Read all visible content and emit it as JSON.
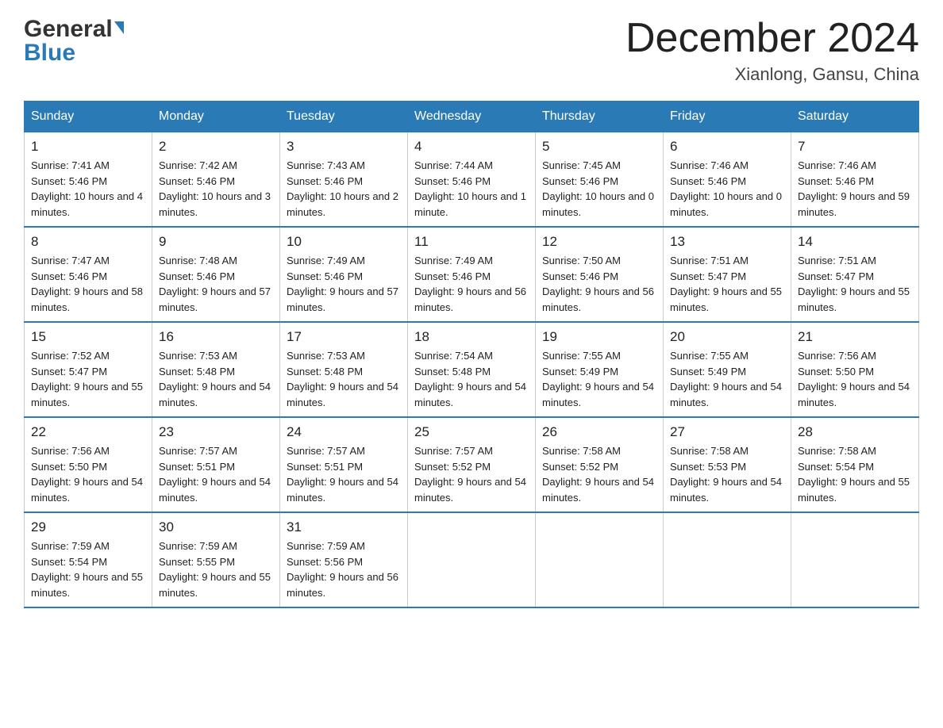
{
  "header": {
    "logo_general": "General",
    "logo_blue": "Blue",
    "month_title": "December 2024",
    "location": "Xianlong, Gansu, China"
  },
  "weekdays": [
    "Sunday",
    "Monday",
    "Tuesday",
    "Wednesday",
    "Thursday",
    "Friday",
    "Saturday"
  ],
  "weeks": [
    [
      {
        "day": "1",
        "sunrise": "7:41 AM",
        "sunset": "5:46 PM",
        "daylight": "10 hours and 4 minutes."
      },
      {
        "day": "2",
        "sunrise": "7:42 AM",
        "sunset": "5:46 PM",
        "daylight": "10 hours and 3 minutes."
      },
      {
        "day": "3",
        "sunrise": "7:43 AM",
        "sunset": "5:46 PM",
        "daylight": "10 hours and 2 minutes."
      },
      {
        "day": "4",
        "sunrise": "7:44 AM",
        "sunset": "5:46 PM",
        "daylight": "10 hours and 1 minute."
      },
      {
        "day": "5",
        "sunrise": "7:45 AM",
        "sunset": "5:46 PM",
        "daylight": "10 hours and 0 minutes."
      },
      {
        "day": "6",
        "sunrise": "7:46 AM",
        "sunset": "5:46 PM",
        "daylight": "10 hours and 0 minutes."
      },
      {
        "day": "7",
        "sunrise": "7:46 AM",
        "sunset": "5:46 PM",
        "daylight": "9 hours and 59 minutes."
      }
    ],
    [
      {
        "day": "8",
        "sunrise": "7:47 AM",
        "sunset": "5:46 PM",
        "daylight": "9 hours and 58 minutes."
      },
      {
        "day": "9",
        "sunrise": "7:48 AM",
        "sunset": "5:46 PM",
        "daylight": "9 hours and 57 minutes."
      },
      {
        "day": "10",
        "sunrise": "7:49 AM",
        "sunset": "5:46 PM",
        "daylight": "9 hours and 57 minutes."
      },
      {
        "day": "11",
        "sunrise": "7:49 AM",
        "sunset": "5:46 PM",
        "daylight": "9 hours and 56 minutes."
      },
      {
        "day": "12",
        "sunrise": "7:50 AM",
        "sunset": "5:46 PM",
        "daylight": "9 hours and 56 minutes."
      },
      {
        "day": "13",
        "sunrise": "7:51 AM",
        "sunset": "5:47 PM",
        "daylight": "9 hours and 55 minutes."
      },
      {
        "day": "14",
        "sunrise": "7:51 AM",
        "sunset": "5:47 PM",
        "daylight": "9 hours and 55 minutes."
      }
    ],
    [
      {
        "day": "15",
        "sunrise": "7:52 AM",
        "sunset": "5:47 PM",
        "daylight": "9 hours and 55 minutes."
      },
      {
        "day": "16",
        "sunrise": "7:53 AM",
        "sunset": "5:48 PM",
        "daylight": "9 hours and 54 minutes."
      },
      {
        "day": "17",
        "sunrise": "7:53 AM",
        "sunset": "5:48 PM",
        "daylight": "9 hours and 54 minutes."
      },
      {
        "day": "18",
        "sunrise": "7:54 AM",
        "sunset": "5:48 PM",
        "daylight": "9 hours and 54 minutes."
      },
      {
        "day": "19",
        "sunrise": "7:55 AM",
        "sunset": "5:49 PM",
        "daylight": "9 hours and 54 minutes."
      },
      {
        "day": "20",
        "sunrise": "7:55 AM",
        "sunset": "5:49 PM",
        "daylight": "9 hours and 54 minutes."
      },
      {
        "day": "21",
        "sunrise": "7:56 AM",
        "sunset": "5:50 PM",
        "daylight": "9 hours and 54 minutes."
      }
    ],
    [
      {
        "day": "22",
        "sunrise": "7:56 AM",
        "sunset": "5:50 PM",
        "daylight": "9 hours and 54 minutes."
      },
      {
        "day": "23",
        "sunrise": "7:57 AM",
        "sunset": "5:51 PM",
        "daylight": "9 hours and 54 minutes."
      },
      {
        "day": "24",
        "sunrise": "7:57 AM",
        "sunset": "5:51 PM",
        "daylight": "9 hours and 54 minutes."
      },
      {
        "day": "25",
        "sunrise": "7:57 AM",
        "sunset": "5:52 PM",
        "daylight": "9 hours and 54 minutes."
      },
      {
        "day": "26",
        "sunrise": "7:58 AM",
        "sunset": "5:52 PM",
        "daylight": "9 hours and 54 minutes."
      },
      {
        "day": "27",
        "sunrise": "7:58 AM",
        "sunset": "5:53 PM",
        "daylight": "9 hours and 54 minutes."
      },
      {
        "day": "28",
        "sunrise": "7:58 AM",
        "sunset": "5:54 PM",
        "daylight": "9 hours and 55 minutes."
      }
    ],
    [
      {
        "day": "29",
        "sunrise": "7:59 AM",
        "sunset": "5:54 PM",
        "daylight": "9 hours and 55 minutes."
      },
      {
        "day": "30",
        "sunrise": "7:59 AM",
        "sunset": "5:55 PM",
        "daylight": "9 hours and 55 minutes."
      },
      {
        "day": "31",
        "sunrise": "7:59 AM",
        "sunset": "5:56 PM",
        "daylight": "9 hours and 56 minutes."
      },
      null,
      null,
      null,
      null
    ]
  ]
}
